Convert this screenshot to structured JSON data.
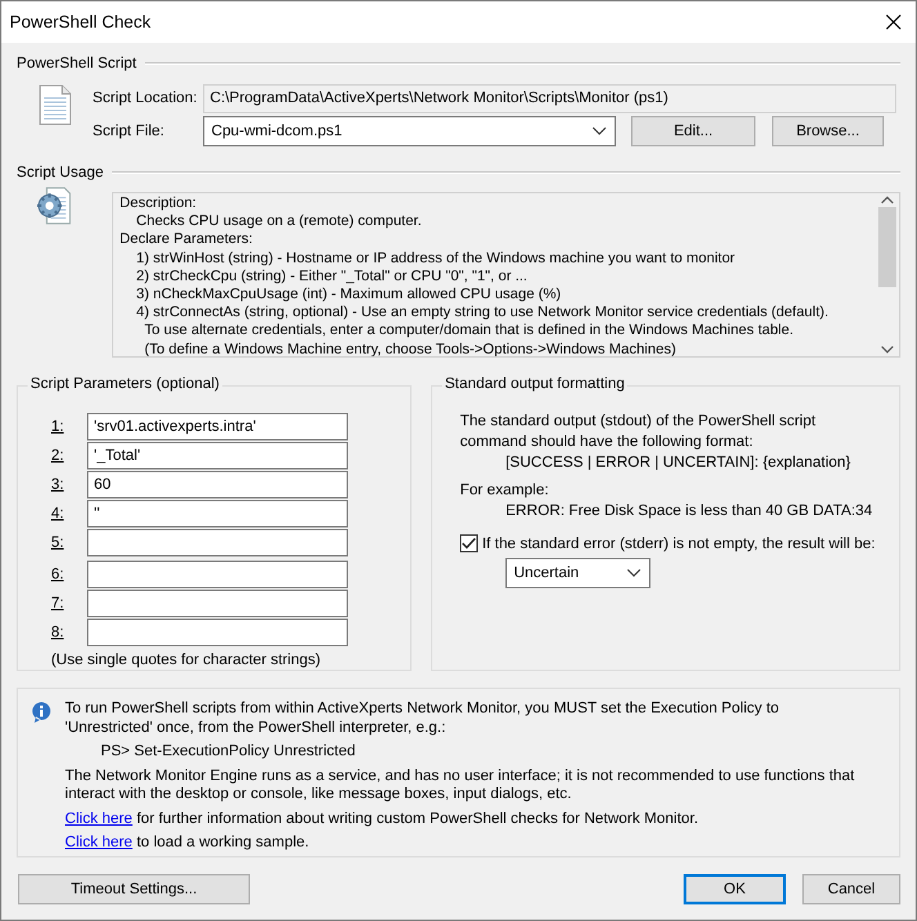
{
  "window": {
    "title": "PowerShell Check"
  },
  "script": {
    "heading": "PowerShell Script",
    "location_label": "Script Location:",
    "location": "C:\\ProgramData\\ActiveXperts\\Network Monitor\\Scripts\\Monitor (ps1)",
    "file_label": "Script File:",
    "file": "Cpu-wmi-dcom.ps1",
    "buttons": [
      "Edit...",
      "Browse..."
    ]
  },
  "usage": {
    "heading": "Script Usage",
    "lines": [
      {
        "kind": "heading",
        "text": "Description:"
      },
      {
        "kind": "item",
        "text": "Checks CPU usage on a (remote) computer."
      },
      {
        "kind": "heading",
        "text": "Declare Parameters:"
      },
      {
        "kind": "item",
        "text": "1) strWinHost (string) - Hostname or IP address of the Windows machine you want to monitor"
      },
      {
        "kind": "item",
        "text": "2) strCheckCpu (string) - Either \"_Total\" or CPU \"0\", \"1\", or ..."
      },
      {
        "kind": "item",
        "text": "3) nCheckMaxCpuUsage (int) - Maximum allowed CPU usage (%)"
      },
      {
        "kind": "item",
        "text": "4) strConnectAs (string, optional) - Use an empty string to use Network Monitor service credentials (default)."
      },
      {
        "kind": "note",
        "text": "To use alternate credentials, enter a computer/domain that is defined in the Windows Machines table."
      },
      {
        "kind": "note",
        "text": "(To define a Windows Machine entry, choose Tools->Options->Windows Machines)"
      }
    ]
  },
  "parameters": {
    "heading": "Script Parameters (optional)",
    "rows": [
      {
        "label": "1:",
        "value": "'srv01.activexperts.intra'"
      },
      {
        "label": "2:",
        "value": "'_Total'"
      },
      {
        "label": "3:",
        "value": "60"
      },
      {
        "label": "4:",
        "value": "''"
      },
      {
        "label": "5:"
      },
      {
        "label": "6:"
      },
      {
        "label": "7:"
      },
      {
        "label": "8:"
      }
    ],
    "hint": "(Use single quotes for character strings)"
  },
  "output": {
    "heading": "Standard output formatting",
    "intro": "The standard output (stdout) of the PowerShell script\ncommand should have the following format:",
    "format": "[SUCCESS | ERROR | UNCERTAIN]: {explanation}",
    "example_label": "For example:",
    "example": "ERROR: Free Disk Space is less than 40 GB DATA:34",
    "stderr": {
      "label": "If the standard error (stderr) is not empty, the result will be:",
      "checked": true
    },
    "result": "Uncertain"
  },
  "info": {
    "paragraphs": [
      {
        "kind": "text",
        "text": "To run PowerShell scripts from within ActiveXperts Network Monitor, you MUST set the Execution Policy to\n'Unrestricted' once, from the PowerShell interpreter, e.g.:"
      },
      {
        "kind": "code",
        "text": "PS> Set-ExecutionPolicy Unrestricted"
      },
      {
        "kind": "text",
        "text": "The Network Monitor Engine runs as a service, and has no user interface; it is not recommended to use functions that\ninteract with the desktop or console, like message boxes, input dialogs, etc."
      },
      {
        "kind": "link",
        "link": "Click here",
        "text": " for further information about writing custom PowerShell checks for Network Monitor."
      },
      {
        "kind": "link",
        "link": "Click here",
        "text": " to load a working sample."
      }
    ]
  },
  "timeout_button": "Timeout Settings...",
  "buttons": [
    {
      "label": "OK",
      "default": true
    },
    {
      "label": "Cancel",
      "default": false
    }
  ]
}
